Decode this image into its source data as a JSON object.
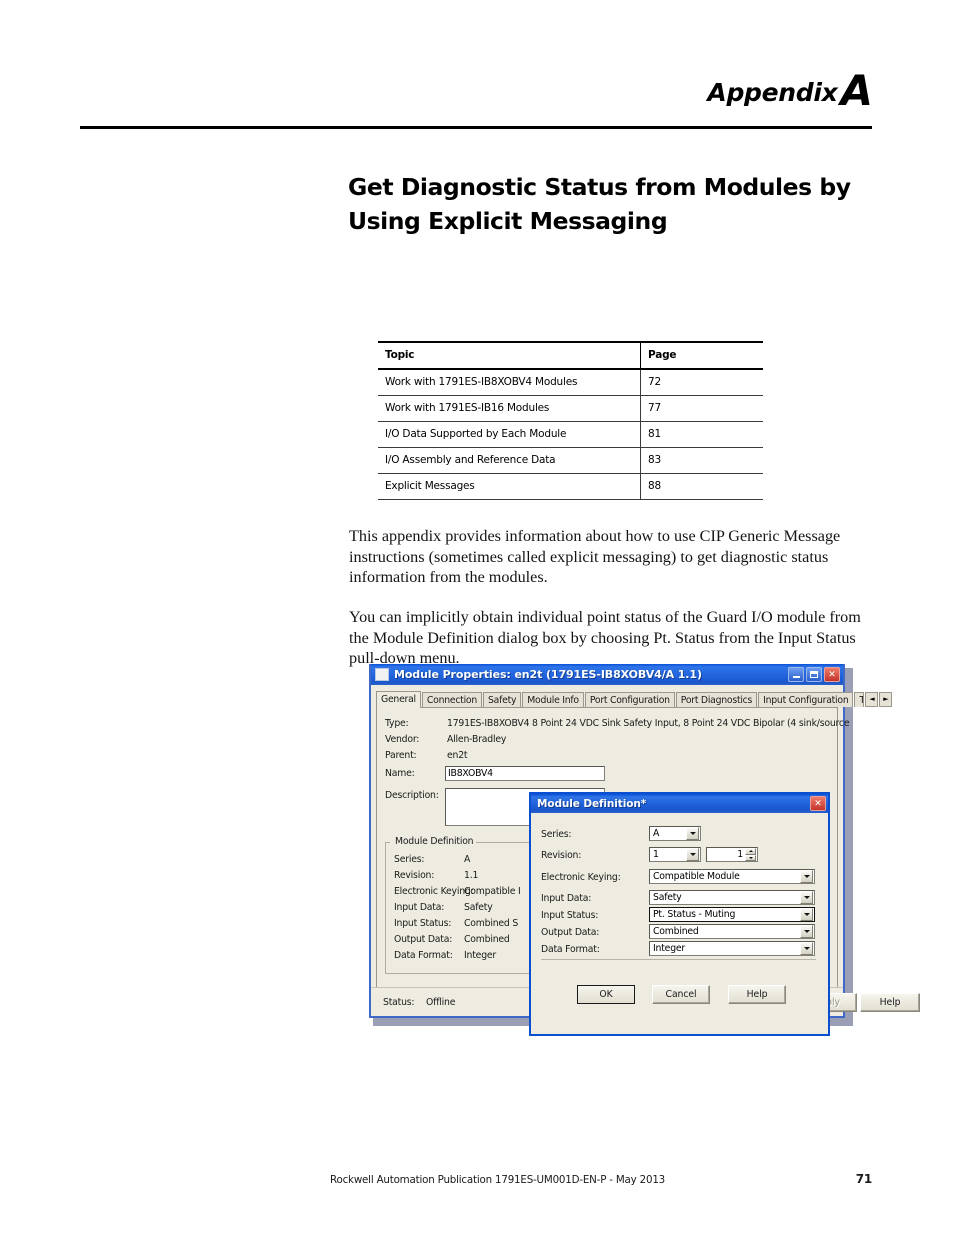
{
  "header": {
    "appendix_word": "Appendix",
    "appendix_letter": "A"
  },
  "page_title": "Get Diagnostic Status from Modules by Using Explicit Messaging",
  "topic_table": {
    "columns": [
      "Topic",
      "Page"
    ],
    "rows": [
      {
        "topic": "Work with 1791ES-IB8XOBV4 Modules",
        "page": "72"
      },
      {
        "topic": "Work with 1791ES-IB16 Modules",
        "page": "77"
      },
      {
        "topic": "I/O Data Supported by Each Module",
        "page": "81"
      },
      {
        "topic": "I/O Assembly and Reference Data",
        "page": "83"
      },
      {
        "topic": "Explicit Messages",
        "page": "88"
      }
    ]
  },
  "paragraphs": {
    "p1": "This appendix provides information about how to use CIP Generic Message instructions (sometimes called explicit messaging) to get diagnostic status information from the modules.",
    "p2": "You can implicitly obtain individual point status of the Guard I/O module from the Module Definition dialog box by choosing Pt. Status from the Input Status pull-down menu."
  },
  "screenshot": {
    "window": {
      "title": "Module Properties: en2t (1791ES-IB8XOBV4/A 1.1)",
      "controls": {
        "minimize": "–",
        "maximize": "□",
        "close": "✕"
      },
      "tabs": [
        {
          "label": "General",
          "active": true
        },
        {
          "label": "Connection",
          "active": false
        },
        {
          "label": "Safety",
          "active": false
        },
        {
          "label": "Module Info",
          "active": false
        },
        {
          "label": "Port Configuration",
          "active": false
        },
        {
          "label": "Port Diagnostics",
          "active": false
        },
        {
          "label": "Input Configuration",
          "active": false
        },
        {
          "label": "Test Outpu",
          "active": false
        }
      ],
      "tab_scroll": {
        "left": "◄",
        "right": "►"
      },
      "fields": {
        "type_label": "Type:",
        "type_value": "1791ES-IB8XOBV4 8 Point 24 VDC Sink Safety Input, 8 Point 24 VDC Bipolar (4 sink/source",
        "vendor_label": "Vendor:",
        "vendor_value": "Allen-Bradley",
        "parent_label": "Parent:",
        "parent_value": "en2t",
        "name_label": "Name:",
        "name_value": "IB8XOBV4",
        "description_label": "Description:",
        "description_value": ""
      },
      "module_definition_group": {
        "title": "Module Definition",
        "rows": [
          {
            "label": "Series:",
            "value": "A"
          },
          {
            "label": "Revision:",
            "value": "1.1"
          },
          {
            "label": "Electronic Keying:",
            "value": "Compatible I"
          },
          {
            "label": "Input Data:",
            "value": "Safety"
          },
          {
            "label": "Input Status:",
            "value": "Combined S"
          },
          {
            "label": "Output Data:",
            "value": "Combined"
          },
          {
            "label": "Data Format:",
            "value": "Integer"
          }
        ]
      },
      "statusbar": {
        "status_label": "Status:",
        "status_value": "Offline",
        "buttons": [
          {
            "label": "OK",
            "disabled": false
          },
          {
            "label": "Cancel",
            "disabled": false
          },
          {
            "label": "Apply",
            "disabled": true
          },
          {
            "label": "Help",
            "disabled": false
          }
        ]
      }
    },
    "modal": {
      "title": "Module Definition*",
      "close": "✕",
      "fields": [
        {
          "label": "Series:",
          "value": "A",
          "control": "combo"
        },
        {
          "label": "Revision:",
          "value": "1",
          "control": "combo",
          "spinner_value": "1"
        },
        {
          "label": "Electronic Keying:",
          "value": "Compatible Module",
          "control": "combo"
        },
        {
          "label": "Input Data:",
          "value": "Safety",
          "control": "combo"
        },
        {
          "label": "Input Status:",
          "value": "Pt. Status - Muting",
          "control": "combo",
          "focused": true
        },
        {
          "label": "Output Data:",
          "value": "Combined",
          "control": "combo"
        },
        {
          "label": "Data Format:",
          "value": "Integer",
          "control": "combo"
        }
      ],
      "buttons": [
        {
          "label": "OK",
          "default": true
        },
        {
          "label": "Cancel",
          "default": false
        },
        {
          "label": "Help",
          "default": false
        }
      ]
    }
  },
  "footer": {
    "publication": "Rockwell Automation Publication 1791ES-UM001D-EN-P - May 2013",
    "page_number": "71"
  }
}
